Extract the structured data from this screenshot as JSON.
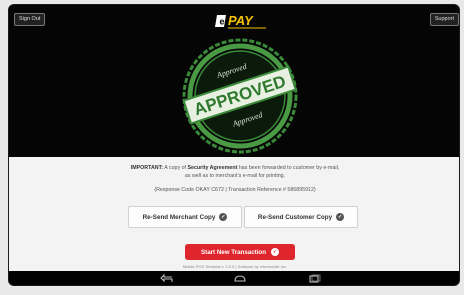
{
  "header": {
    "sign_out_label": "Sign Out",
    "support_label": "Support",
    "logo_text": "PAY",
    "logo_prefix": "e"
  },
  "stamp": {
    "main_text": "APPROVED",
    "top_text": "Approved",
    "bottom_text": "Approved",
    "color": "#3a8a3a"
  },
  "message": {
    "prefix": "IMPORTANT:",
    "line1_a": " A copy of ",
    "line1_bold": "Security Agreement",
    "line1_b": " has been forwarded to customer by e-mail,",
    "line2": "as well as to merchant's e-mail for printing.",
    "response_line": "(Response Code OKAY C672 | Transaction Reference # 586895912)"
  },
  "actions": {
    "resend_merchant": "Re-Send Merchant Copy",
    "resend_customer": "Re-Send Customer Copy",
    "start_new": "Start New Transaction"
  },
  "footer": {
    "version_text": "Mobile POS Terminal v. 3.0.0 | Software by Intermobile Inc."
  },
  "colors": {
    "accent_red": "#e0262d",
    "logo_yellow": "#f5c400"
  }
}
